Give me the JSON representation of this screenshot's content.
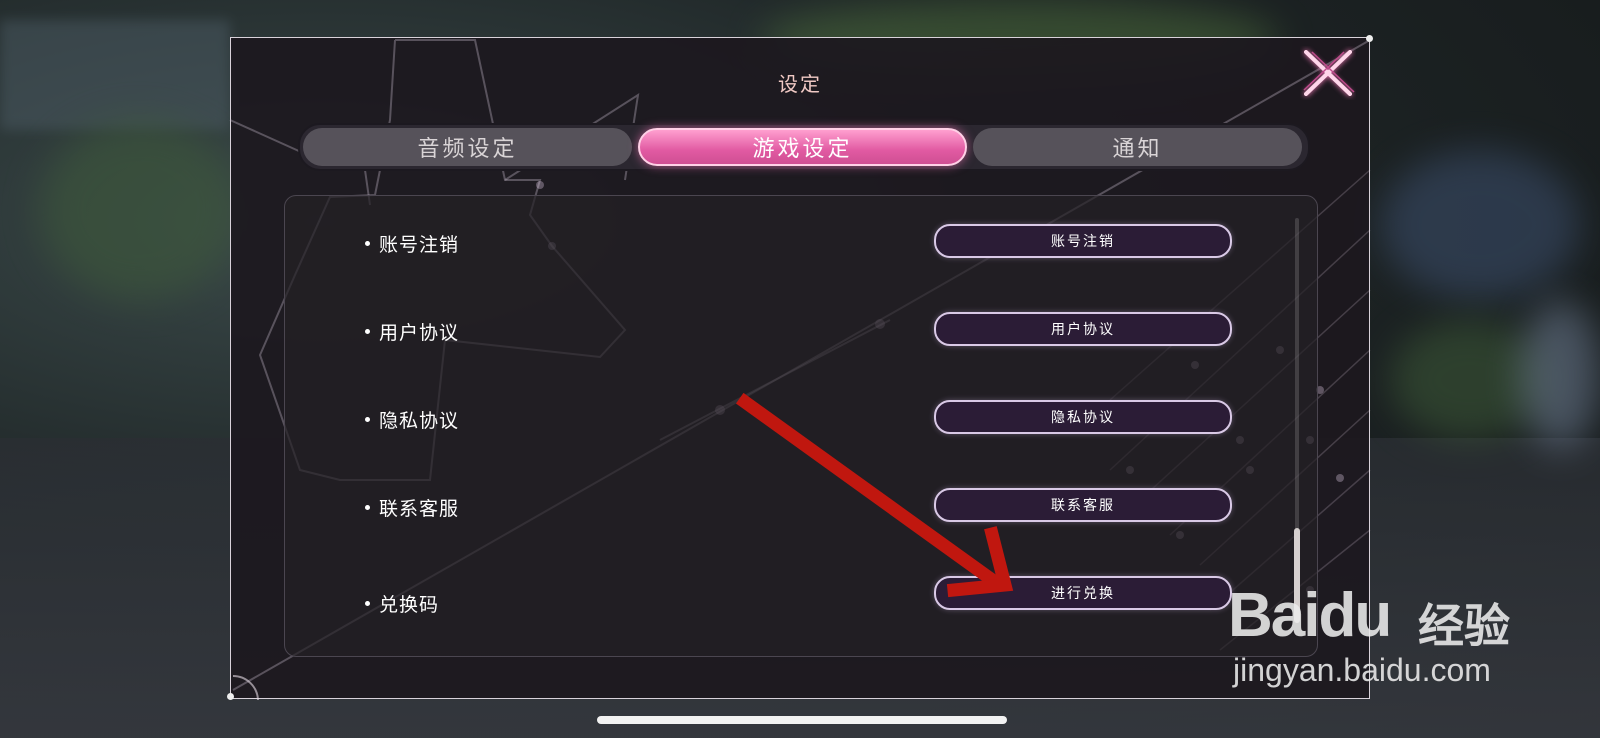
{
  "dialog": {
    "title": "设定",
    "close_icon": "close-icon"
  },
  "tabs": [
    {
      "label": "音频设定",
      "active": false
    },
    {
      "label": "游戏设定",
      "active": true
    },
    {
      "label": "通知",
      "active": false
    }
  ],
  "settings": [
    {
      "label": "账号注销",
      "button": "账号注销"
    },
    {
      "label": "用户协议",
      "button": "用户协议"
    },
    {
      "label": "隐私协议",
      "button": "隐私协议"
    },
    {
      "label": "联系客服",
      "button": "联系客服"
    },
    {
      "label": "兑换码",
      "button": "进行兑换"
    }
  ],
  "annotation": {
    "arrow_color": "#c0170f",
    "arrow_icon": "red-arrow-icon"
  },
  "watermark": {
    "logo": "Baidu",
    "cn": "经验",
    "url": "jingyan.baidu.com"
  },
  "colors": {
    "accent": "#e15aa2",
    "button_bg": "#2b1c36",
    "panel_border": "#d9d2da"
  }
}
